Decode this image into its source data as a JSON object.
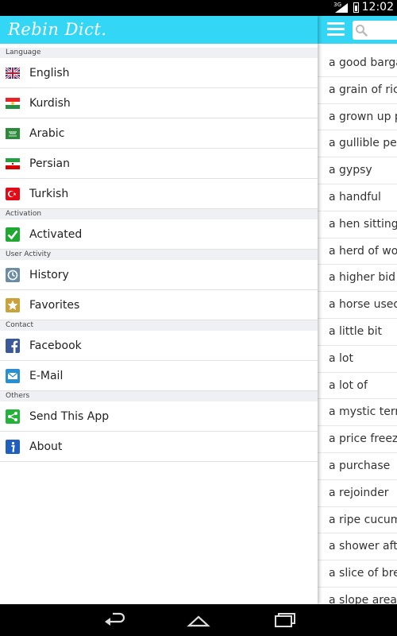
{
  "status": {
    "network": "3G",
    "time": "12:02"
  },
  "app": {
    "title": "Rebin Dict."
  },
  "menu": [
    {
      "header": "Language",
      "items": [
        {
          "label": "English",
          "icon": "uk-flag-icon"
        },
        {
          "label": "Kurdish",
          "icon": "kurdistan-flag-icon"
        },
        {
          "label": "Arabic",
          "icon": "saudi-flag-icon"
        },
        {
          "label": "Persian",
          "icon": "iran-flag-icon"
        },
        {
          "label": "Turkish",
          "icon": "turkey-flag-icon"
        }
      ]
    },
    {
      "header": "Activation",
      "items": [
        {
          "label": "Activated",
          "icon": "checkmark-icon"
        }
      ]
    },
    {
      "header": "User Activity",
      "items": [
        {
          "label": "History",
          "icon": "history-clock-icon"
        },
        {
          "label": "Favorites",
          "icon": "star-icon"
        }
      ]
    },
    {
      "header": "Contact",
      "items": [
        {
          "label": "Facebook",
          "icon": "facebook-icon"
        },
        {
          "label": "E-Mail",
          "icon": "mail-icon"
        }
      ]
    },
    {
      "header": "Others",
      "items": [
        {
          "label": "Send This App",
          "icon": "share-icon"
        },
        {
          "label": "About",
          "icon": "info-icon"
        }
      ]
    }
  ],
  "words": [
    "a good barga",
    "a grain of rice",
    "a grown up p",
    "a gullible pers",
    "a gypsy",
    "a handful",
    "a hen sitting",
    "a herd of wolv",
    "a higher bid",
    "a horse used",
    "a little bit",
    "a lot",
    "a lot of",
    "a mystic term",
    "a price freeze",
    "a purchase",
    "a rejoinder",
    "a ripe cucum",
    "a shower afte",
    "a slice of brea",
    "a slope area"
  ],
  "colors": {
    "accent": "#33d6f5",
    "section": "#eef0f4"
  }
}
